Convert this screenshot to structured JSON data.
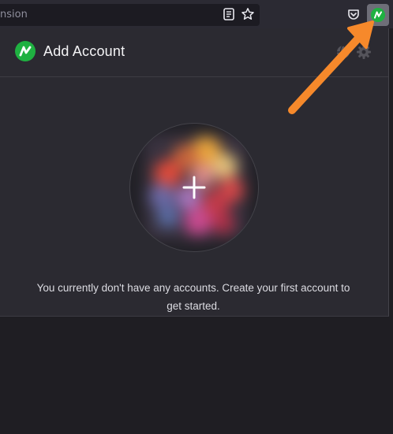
{
  "browser": {
    "url_text": "nsion",
    "icons": [
      "reader-view-icon",
      "bookmark-star-icon",
      "pocket-icon",
      "extension-icon"
    ]
  },
  "popup": {
    "header": {
      "title": "Add Account",
      "icons": [
        "globe-icon",
        "gear-icon"
      ]
    },
    "avatar": {
      "icon": "plus-icon"
    },
    "empty_message": "You currently don't have any accounts. Create your first account to get started."
  },
  "colors": {
    "brand_green": "#1fb141",
    "annotation_arrow": "#f6892b",
    "popup_background": "#2b2a31",
    "page_background": "#1f1e23"
  }
}
